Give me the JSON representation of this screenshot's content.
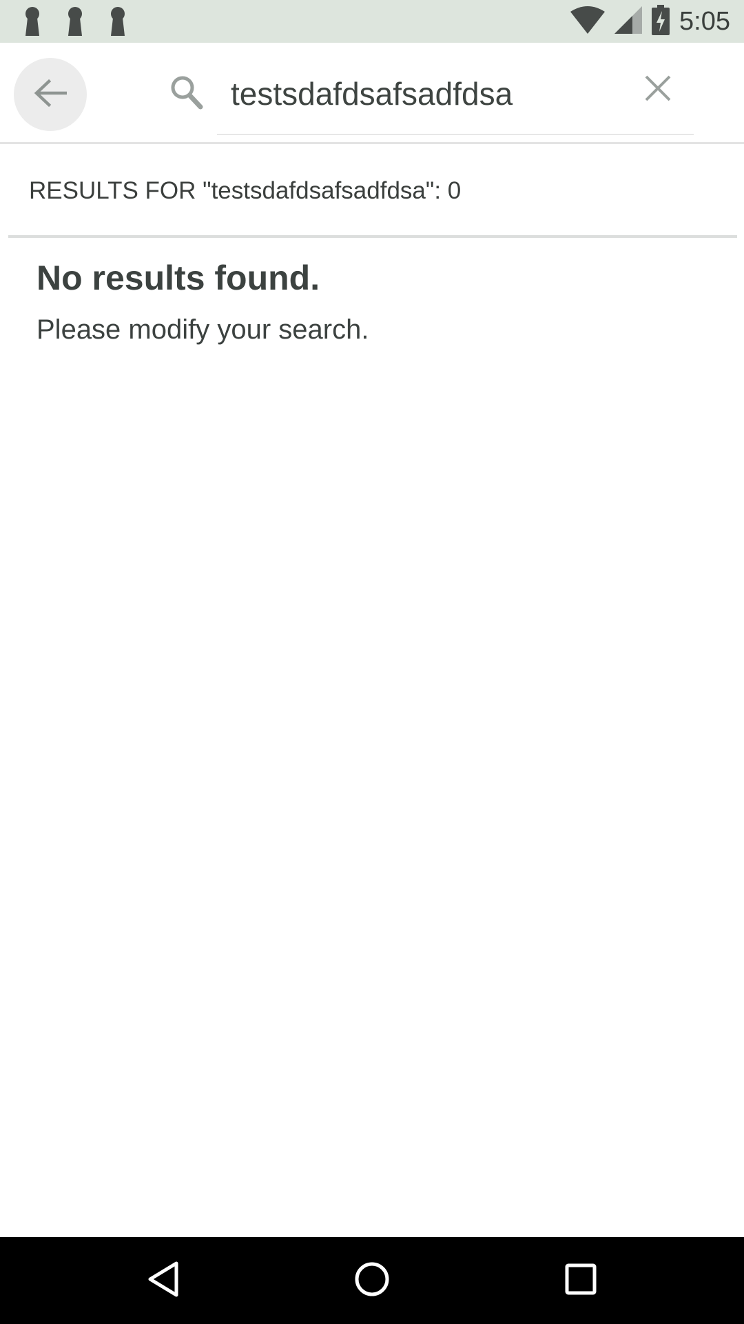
{
  "status_bar": {
    "time": "5:05",
    "notification_icons": [
      "keyhole-icon",
      "keyhole-icon",
      "keyhole-icon"
    ],
    "indicators": [
      "wifi-icon",
      "cell-signal-icon",
      "battery-charging-icon"
    ]
  },
  "search": {
    "query": "testsdafdsafsadfdsa",
    "back_icon": "arrow-left-icon",
    "search_icon": "search-icon",
    "clear_icon": "close-icon"
  },
  "results": {
    "header": "RESULTS FOR \"testsdafdsafsadfdsa\": 0",
    "empty_title": "No results found.",
    "empty_message": "Please modify your search."
  },
  "nav_bar": {
    "buttons": [
      "triangle-back-icon",
      "circle-home-icon",
      "square-recents-icon"
    ]
  },
  "colors": {
    "status_bar_bg": "#dde5dd",
    "text_primary": "#3c4240",
    "icon_gray": "#9aa09d",
    "nav_bar_bg": "#000000"
  }
}
